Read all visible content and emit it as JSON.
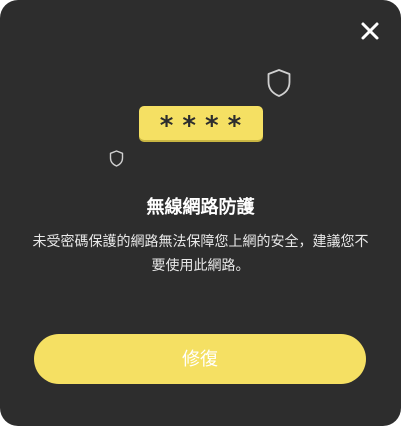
{
  "dialog": {
    "close_icon": "close-icon",
    "pin_text": "****",
    "title": "無線網路防護",
    "description": "未受密碼保護的網路無法保障您上網的安全，建議您不要使用此網路。",
    "fix_button_label": "修復"
  },
  "icons": {
    "decoration_large": "shield-icon",
    "decoration_small": "shield-icon"
  },
  "colors": {
    "background": "#2d2d2d",
    "accent": "#f5e063",
    "text": "#ffffff"
  }
}
